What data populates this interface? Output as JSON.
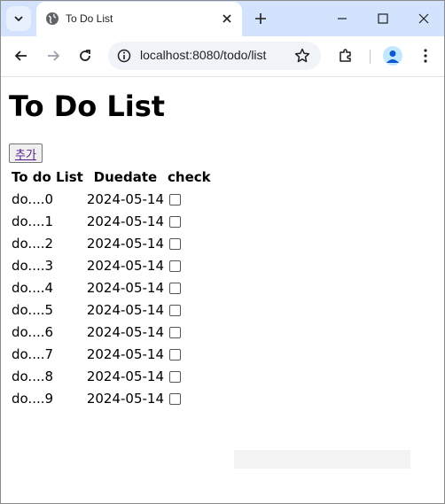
{
  "browser": {
    "tab_title": "To Do List",
    "url": "localhost:8080/todo/list"
  },
  "page": {
    "heading": "To Do List",
    "add_button_label": "추가",
    "table": {
      "headers": [
        "To do List",
        "Duedate",
        "check"
      ],
      "rows": [
        {
          "title": "do....0",
          "due": "2024-05-14",
          "checked": false
        },
        {
          "title": "do....1",
          "due": "2024-05-14",
          "checked": false
        },
        {
          "title": "do....2",
          "due": "2024-05-14",
          "checked": false
        },
        {
          "title": "do....3",
          "due": "2024-05-14",
          "checked": false
        },
        {
          "title": "do....4",
          "due": "2024-05-14",
          "checked": false
        },
        {
          "title": "do....5",
          "due": "2024-05-14",
          "checked": false
        },
        {
          "title": "do....6",
          "due": "2024-05-14",
          "checked": false
        },
        {
          "title": "do....7",
          "due": "2024-05-14",
          "checked": false
        },
        {
          "title": "do....8",
          "due": "2024-05-14",
          "checked": false
        },
        {
          "title": "do....9",
          "due": "2024-05-14",
          "checked": false
        }
      ]
    }
  },
  "icons": {
    "tab_search": "chevron-down-icon",
    "favicon": "globe-icon",
    "tab_close": "close-icon",
    "new_tab": "plus-icon",
    "minimize": "minimize-icon",
    "maximize": "maximize-icon",
    "close_window": "close-window-icon",
    "back": "back-arrow-icon",
    "forward": "forward-arrow-icon",
    "reload": "reload-icon",
    "site_info": "info-icon",
    "bookmark": "star-icon",
    "extensions": "puzzle-icon",
    "profile": "avatar",
    "menu": "kebab-menu-icon"
  },
  "colors": {
    "tab_strip": "#d3e3fd",
    "omnibox": "#f0f4f9",
    "link_visited": "#551a8b"
  }
}
